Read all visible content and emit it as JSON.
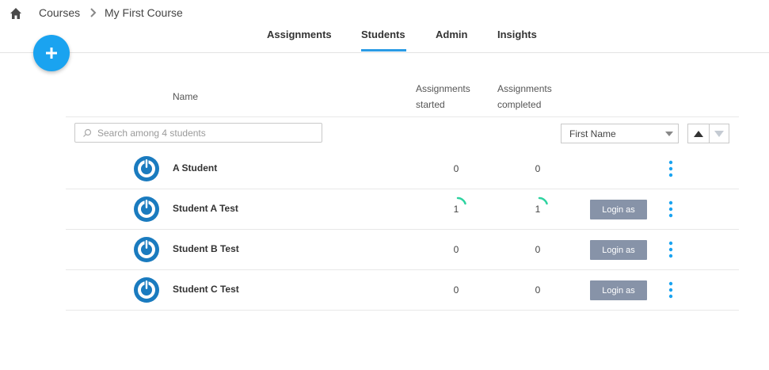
{
  "breadcrumb": {
    "root_icon": "home-icon",
    "items": [
      "Courses",
      "My First Course"
    ],
    "separator_icon": "chevron-right-icon"
  },
  "tabs": [
    {
      "label": "Assignments",
      "active": false
    },
    {
      "label": "Students",
      "active": true
    },
    {
      "label": "Admin",
      "active": false
    },
    {
      "label": "Insights",
      "active": false
    }
  ],
  "fab": {
    "icon": "plus-icon"
  },
  "table": {
    "columns": {
      "name": "Name",
      "started_line1": "Assignments",
      "started_line2": "started",
      "completed_line1": "Assignments",
      "completed_line2": "completed"
    },
    "search": {
      "placeholder": "Search among 4 students",
      "value": ""
    },
    "sort": {
      "selected": "First Name",
      "direction": "ascending"
    },
    "rows": [
      {
        "name": "A Student",
        "started": "0",
        "completed": "0",
        "show_login": false,
        "login_label": "Login as",
        "progress_arc": false
      },
      {
        "name": "Student A Test",
        "started": "1",
        "completed": "1",
        "show_login": true,
        "login_label": "Login as",
        "progress_arc": true
      },
      {
        "name": "Student B Test",
        "started": "0",
        "completed": "0",
        "show_login": true,
        "login_label": "Login as",
        "progress_arc": false
      },
      {
        "name": "Student C Test",
        "started": "0",
        "completed": "0",
        "show_login": true,
        "login_label": "Login as",
        "progress_arc": false
      }
    ]
  },
  "colors": {
    "accent": "#1aa3f0",
    "tab_underline": "#2b9be5",
    "avatar": "#1a7bbf",
    "progress": "#2ed3a0",
    "login_button": "#8793a8"
  }
}
